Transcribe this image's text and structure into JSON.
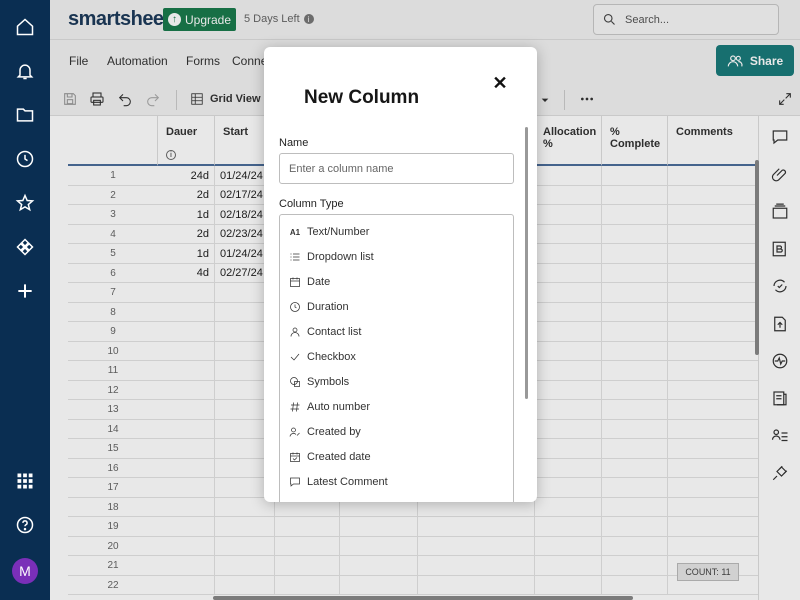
{
  "app": {
    "logo": "smartsheet",
    "upgrade_label": "Upgrade",
    "trial_text": "5 Days Left",
    "search_placeholder": "Search...",
    "avatar_initial": "M"
  },
  "menu": {
    "items": [
      "File",
      "Automation",
      "Forms",
      "Conne"
    ],
    "share_label": "Share"
  },
  "toolbar": {
    "view_label": "Grid View"
  },
  "grid": {
    "columns": [
      "Dauer",
      "Start",
      "Allocation %",
      "% Complete",
      "Comments"
    ],
    "rows": [
      {
        "num": "1",
        "dauer": "24d",
        "start": "01/24/24"
      },
      {
        "num": "2",
        "dauer": "2d",
        "start": "02/17/24"
      },
      {
        "num": "3",
        "dauer": "1d",
        "start": "02/18/24"
      },
      {
        "num": "4",
        "dauer": "2d",
        "start": "02/23/24"
      },
      {
        "num": "5",
        "dauer": "1d",
        "start": "01/24/24"
      },
      {
        "num": "6",
        "dauer": "4d",
        "start": "02/27/24"
      },
      {
        "num": "7",
        "dauer": "",
        "start": ""
      },
      {
        "num": "8",
        "dauer": "",
        "start": ""
      },
      {
        "num": "9",
        "dauer": "",
        "start": ""
      },
      {
        "num": "10",
        "dauer": "",
        "start": ""
      },
      {
        "num": "11",
        "dauer": "",
        "start": ""
      },
      {
        "num": "12",
        "dauer": "",
        "start": ""
      },
      {
        "num": "13",
        "dauer": "",
        "start": ""
      },
      {
        "num": "14",
        "dauer": "",
        "start": ""
      },
      {
        "num": "15",
        "dauer": "",
        "start": ""
      },
      {
        "num": "16",
        "dauer": "",
        "start": ""
      },
      {
        "num": "17",
        "dauer": "",
        "start": ""
      },
      {
        "num": "18",
        "dauer": "",
        "start": ""
      },
      {
        "num": "19",
        "dauer": "",
        "start": ""
      },
      {
        "num": "20",
        "dauer": "",
        "start": ""
      },
      {
        "num": "21",
        "dauer": "",
        "start": ""
      },
      {
        "num": "22",
        "dauer": "",
        "start": ""
      }
    ],
    "count_label": "COUNT:",
    "count_value": "11"
  },
  "modal": {
    "title": "New Column",
    "name_label": "Name",
    "name_placeholder": "Enter a column name",
    "type_label": "Column Type",
    "types": [
      {
        "label": "Text/Number",
        "icon": "text-number-icon"
      },
      {
        "label": "Dropdown list",
        "icon": "list-icon"
      },
      {
        "label": "Date",
        "icon": "calendar-icon"
      },
      {
        "label": "Duration",
        "icon": "clock-icon"
      },
      {
        "label": "Contact list",
        "icon": "person-icon"
      },
      {
        "label": "Checkbox",
        "icon": "check-icon"
      },
      {
        "label": "Symbols",
        "icon": "symbols-icon"
      },
      {
        "label": "Auto number",
        "icon": "hash-icon"
      },
      {
        "label": "Created by",
        "icon": "person-edit-icon"
      },
      {
        "label": "Created date",
        "icon": "calendar-check-icon"
      },
      {
        "label": "Latest Comment",
        "icon": "comment-icon"
      }
    ]
  },
  "colors": {
    "nav_bg": "#0a2e52",
    "upgrade_green": "#1a7a4c",
    "share_teal": "#1a7a7a",
    "avatar_purple": "#7a2fb8"
  }
}
